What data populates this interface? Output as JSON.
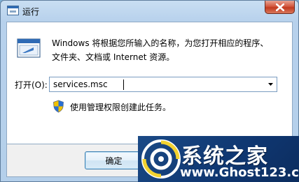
{
  "window": {
    "title": "运行",
    "description": "Windows 将根据您所输入的名称，为您打开相应的程序、\n文件夹、文档或 Internet 资源。",
    "open_label": "打开(O):",
    "command_value": "services.msc",
    "admin_note": "使用管理权限创建此任务。",
    "ok_label": "确定"
  },
  "icons": {
    "app": "run-window-icon",
    "close": "close-icon",
    "run": "run-program-icon",
    "dropdown": "chevron-down-icon",
    "shield": "uac-shield-icon"
  },
  "watermark": {
    "title": "系统之家",
    "url": "www.Ghost123.com"
  },
  "colors": {
    "close_button": "#d3583f",
    "watermark_bg": "#0f3670",
    "shield_blue": "#2b6fd1",
    "shield_yellow": "#f2c200"
  }
}
